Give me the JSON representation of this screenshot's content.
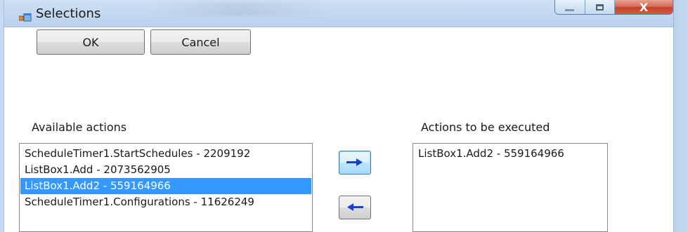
{
  "window": {
    "title": "Selections",
    "icon": "app-icon",
    "caption_buttons": {
      "minimize_icon": "minimize-icon",
      "maximize_icon": "maximize-icon",
      "close_icon": "close-icon",
      "close_glyph": "X"
    }
  },
  "buttons": {
    "ok_label": "OK",
    "cancel_label": "Cancel",
    "add_icon": "arrow-right-icon",
    "remove_icon": "arrow-left-icon"
  },
  "available": {
    "label": "Available actions",
    "items": [
      {
        "text": "ScheduleTimer1.StartSchedules - 2209192",
        "selected": false
      },
      {
        "text": "ListBox1.Add - 2073562905",
        "selected": false
      },
      {
        "text": "ListBox1.Add2 - 559164966",
        "selected": true
      },
      {
        "text": "ScheduleTimer1.Configurations - 11626249",
        "selected": false
      }
    ]
  },
  "executed": {
    "label": "Actions to be executed",
    "items": [
      {
        "text": "ListBox1.Add2 - 559164966",
        "selected": false
      }
    ]
  },
  "colors": {
    "selection_bg": "#3399ff",
    "selection_fg": "#ffffff",
    "arrow_blue": "#1a3fd6",
    "close_red": "#c3412b"
  }
}
